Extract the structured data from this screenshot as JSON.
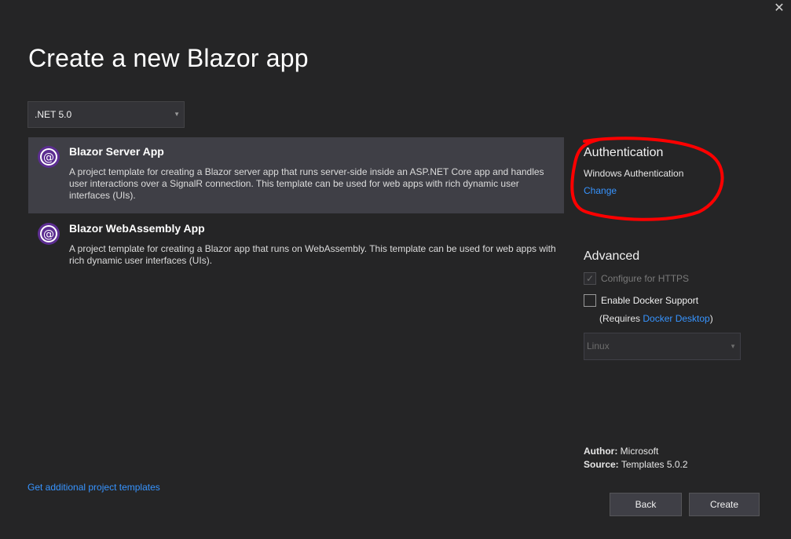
{
  "window": {
    "close_glyph": "✕"
  },
  "title": "Create a new Blazor app",
  "framework": {
    "selected": ".NET 5.0",
    "caret": "▼"
  },
  "templates": [
    {
      "name": "Blazor Server App",
      "description": "A project template for creating a Blazor server app that runs server-side inside an ASP.NET Core app and handles user interactions over a SignalR connection. This template can be used for web apps with rich dynamic user interfaces (UIs).",
      "icon": "blazor-icon",
      "selected": true
    },
    {
      "name": "Blazor WebAssembly App",
      "description": "A project template for creating a Blazor app that runs on WebAssembly. This template can be used for web apps with rich dynamic user interfaces (UIs).",
      "icon": "blazor-icon",
      "selected": false
    }
  ],
  "authentication": {
    "heading": "Authentication",
    "value": "Windows Authentication",
    "change_link": "Change"
  },
  "advanced": {
    "heading": "Advanced",
    "https_label": "Configure for HTTPS",
    "https_checked": true,
    "https_disabled": true,
    "docker_label": "Enable Docker Support",
    "docker_checked": false,
    "requires_prefix": "(Requires ",
    "requires_link": "Docker Desktop",
    "requires_suffix": ")",
    "os_value": "Linux"
  },
  "meta": {
    "author_label": "Author:",
    "author_value": "Microsoft",
    "source_label": "Source:",
    "source_value": "Templates 5.0.2"
  },
  "more_templates_link": "Get additional project templates",
  "buttons": {
    "back": "Back",
    "create": "Create"
  },
  "colors": {
    "background": "#252526",
    "selected_row": "#3f3f46",
    "link": "#3794ff",
    "blazor_purple": "#5c2d91",
    "annotation": "#ff0000"
  }
}
